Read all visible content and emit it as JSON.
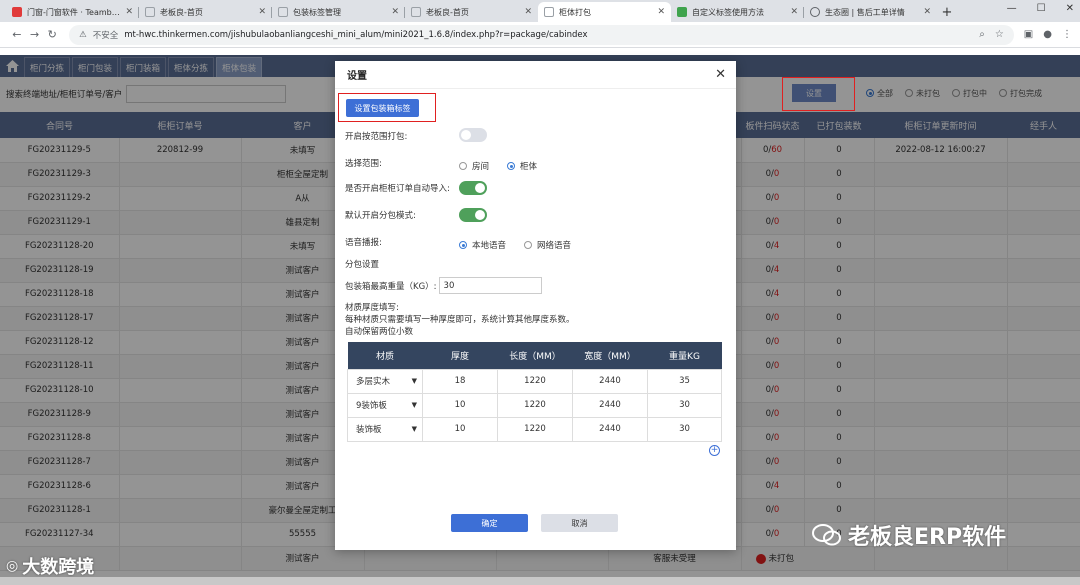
{
  "browser": {
    "tabs": [
      {
        "title": "门窗-门窗软件 · Teambition",
        "color": "#e03a3a",
        "active": false
      },
      {
        "title": "老板良-首页",
        "color": "#9aa0a6",
        "active": false
      },
      {
        "title": "包装标签管理",
        "color": "#9aa0a6",
        "active": false
      },
      {
        "title": "老板良-首页",
        "color": "#9aa0a6",
        "active": false
      },
      {
        "title": "柜体打包",
        "color": "#9aa0a6",
        "active": true
      },
      {
        "title": "自定义标签使用方法",
        "color": "#3fa34d",
        "active": false
      },
      {
        "title": "生态圈 | 售后工单详情",
        "color": "#5f6368",
        "active": false
      }
    ],
    "security_label": "不安全",
    "url": "mt-hwc.thinkermen.com/jishubulaobanliangceshi_mini_alum/mini2021_1.6.8/index.php?r=package/cabindex"
  },
  "app": {
    "nav_tabs": [
      "柜门分拣",
      "柜门包装",
      "柜门装箱",
      "柜体分拣",
      "柜体包装"
    ],
    "active_nav": 4,
    "search_label": "搜索终端地址/柜柜订单号/客户",
    "query_button": "查询",
    "settings_button": "设置",
    "filters": [
      "全部",
      "未打包",
      "打包中",
      "打包完成"
    ],
    "selected_filter": 0,
    "table": {
      "headers": [
        "合同号",
        "柜柜订单号",
        "客户",
        "",
        "",
        "",
        "板件扫码状态",
        "已打包装数",
        "柜柜订单更新时间",
        "经手人"
      ],
      "rows": [
        [
          "FG20231129-5",
          "220812-99",
          "未填写",
          "0/60",
          "0",
          "2022-08-12 16:00:27",
          ""
        ],
        [
          "FG20231129-3",
          "",
          "柜柜全屋定制",
          "0/0",
          "0",
          "",
          ""
        ],
        [
          "FG20231129-2",
          "",
          "A从",
          "0/0",
          "0",
          "",
          ""
        ],
        [
          "FG20231129-1",
          "",
          "雄县定制",
          "0/0",
          "0",
          "",
          ""
        ],
        [
          "FG20231128-20",
          "",
          "未填写",
          "0/4",
          "0",
          "",
          ""
        ],
        [
          "FG20231128-19",
          "",
          "测试客户",
          "0/4",
          "0",
          "",
          ""
        ],
        [
          "FG20231128-18",
          "",
          "测试客户",
          "0/4",
          "0",
          "",
          ""
        ],
        [
          "FG20231128-17",
          "",
          "测试客户",
          "0/0",
          "0",
          "",
          ""
        ],
        [
          "FG20231128-12",
          "",
          "测试客户",
          "0/0",
          "0",
          "",
          ""
        ],
        [
          "FG20231128-11",
          "",
          "测试客户",
          "0/0",
          "0",
          "",
          ""
        ],
        [
          "FG20231128-10",
          "",
          "测试客户",
          "0/0",
          "0",
          "",
          ""
        ],
        [
          "FG20231128-9",
          "",
          "测试客户",
          "0/0",
          "0",
          "",
          ""
        ],
        [
          "FG20231128-8",
          "",
          "测试客户",
          "0/0",
          "0",
          "",
          ""
        ],
        [
          "FG20231128-7",
          "",
          "测试客户",
          "0/0",
          "0",
          "",
          ""
        ],
        [
          "FG20231128-6",
          "",
          "测试客户",
          "0/4",
          "0",
          "",
          ""
        ],
        [
          "FG20231128-1",
          "",
          "豪尔曼全屋定制工",
          "0/0",
          "0",
          "",
          ""
        ],
        [
          "FG20231127-34",
          "",
          "55555",
          "0/0",
          "0",
          "",
          ""
        ]
      ],
      "last_row": {
        "customer": "测试客户",
        "receive_status": "客服未受理",
        "pack_status": "未打包"
      }
    }
  },
  "modal": {
    "title": "设置",
    "set_label_button": "设置包装箱标签",
    "range_pack_label": "开启按范围打包:",
    "range_pack_on": false,
    "select_range_label": "选择范围:",
    "range_options": [
      "房间",
      "柜体"
    ],
    "range_selected": 1,
    "auto_import_label": "是否开启柜柜订单自动导入:",
    "auto_import_on": true,
    "split_default_label": "默认开启分包模式:",
    "split_default_on": true,
    "voice_label": "语音播报:",
    "voice_options": [
      "本地语音",
      "网络语音"
    ],
    "voice_selected": 0,
    "split_settings_title": "分包设置",
    "max_weight_label": "包装箱最高重量（KG）:",
    "max_weight_value": "30",
    "thickness_title": "材质厚度填写:",
    "thickness_note1": "每种材质只需要填写一种厚度即可，系统计算其他厚度系数。",
    "thickness_note2": "自动保留两位小数",
    "materials_headers": [
      "材质",
      "厚度",
      "长度（MM）",
      "宽度（MM）",
      "重量KG"
    ],
    "materials": [
      [
        "多层实木",
        "18",
        "1220",
        "2440",
        "35"
      ],
      [
        "9装饰板",
        "10",
        "1220",
        "2440",
        "30"
      ],
      [
        "装饰板",
        "10",
        "1220",
        "2440",
        "30"
      ]
    ],
    "ok_button": "确定",
    "cancel_button": "取消"
  },
  "watermarks": {
    "right": "老板良ERP软件",
    "left": "大数跨境"
  },
  "colors": {
    "nav_bg": "#5b6e97",
    "primary": "#3d6fd6",
    "switch_on": "#4fa05b",
    "highlight_box": "#e02020"
  }
}
